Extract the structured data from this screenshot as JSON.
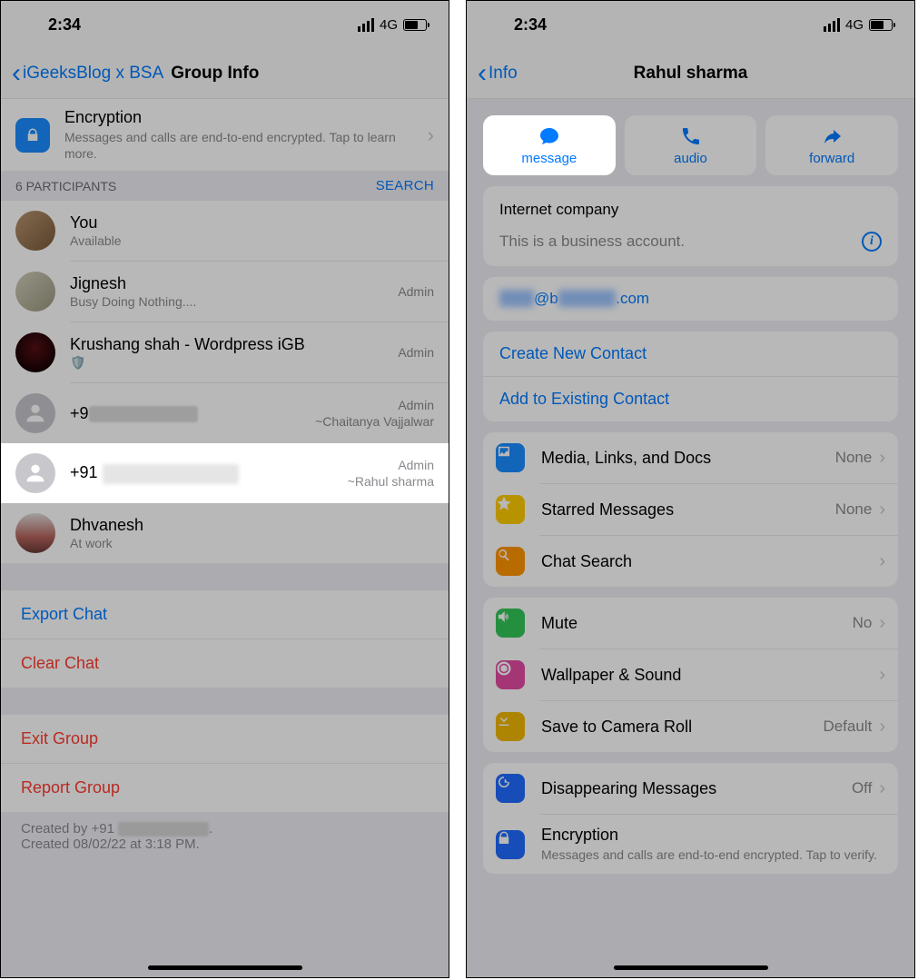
{
  "status": {
    "time": "2:34",
    "network": "4G"
  },
  "left": {
    "back_label": "iGeeksBlog x BSA",
    "title": "Group Info",
    "encryption": {
      "title": "Encryption",
      "sub": "Messages and calls are end-to-end encrypted. Tap to learn more."
    },
    "participants_header": "6 PARTICIPANTS",
    "search_label": "SEARCH",
    "participants": [
      {
        "name": "You",
        "status": "Available",
        "role": "",
        "alias": ""
      },
      {
        "name": "Jignesh",
        "status": "Busy Doing Nothing....",
        "role": "Admin",
        "alias": ""
      },
      {
        "name": "Krushang shah - Wordpress iGB",
        "status": "",
        "role": "Admin",
        "alias": "",
        "badge": true
      },
      {
        "name_prefix": "+9",
        "role": "Admin",
        "alias": "~Chaitanya Vajjalwar"
      },
      {
        "name_prefix": "+91",
        "role": "Admin",
        "alias": "~Rahul sharma"
      },
      {
        "name": "Dhvanesh",
        "status": "At work",
        "role": "",
        "alias": ""
      }
    ],
    "actions": {
      "export": "Export Chat",
      "clear": "Clear Chat",
      "exit": "Exit Group",
      "report": "Report Group"
    },
    "footer_created_by_prefix": "Created by +91",
    "footer_created_on": "Created 08/02/22 at 3:18 PM."
  },
  "right": {
    "back_label": "Info",
    "title": "Rahul sharma",
    "tiles": {
      "message": "message",
      "audio": "audio",
      "forward": "forward"
    },
    "business": {
      "category": "Internet company",
      "notice": "This is a business account."
    },
    "email_visible": ".com",
    "email_mid": "@b",
    "links": {
      "create": "Create New Contact",
      "add": "Add to Existing Contact"
    },
    "settings": {
      "media": {
        "label": "Media, Links, and Docs",
        "value": "None"
      },
      "starred": {
        "label": "Starred Messages",
        "value": "None"
      },
      "search": {
        "label": "Chat Search",
        "value": ""
      },
      "mute": {
        "label": "Mute",
        "value": "No"
      },
      "wallpaper": {
        "label": "Wallpaper & Sound",
        "value": ""
      },
      "camera_roll": {
        "label": "Save to Camera Roll",
        "value": "Default"
      },
      "disappearing": {
        "label": "Disappearing Messages",
        "value": "Off"
      },
      "encryption": {
        "label": "Encryption",
        "sub": "Messages and calls are end-to-end encrypted. Tap to verify."
      }
    }
  }
}
